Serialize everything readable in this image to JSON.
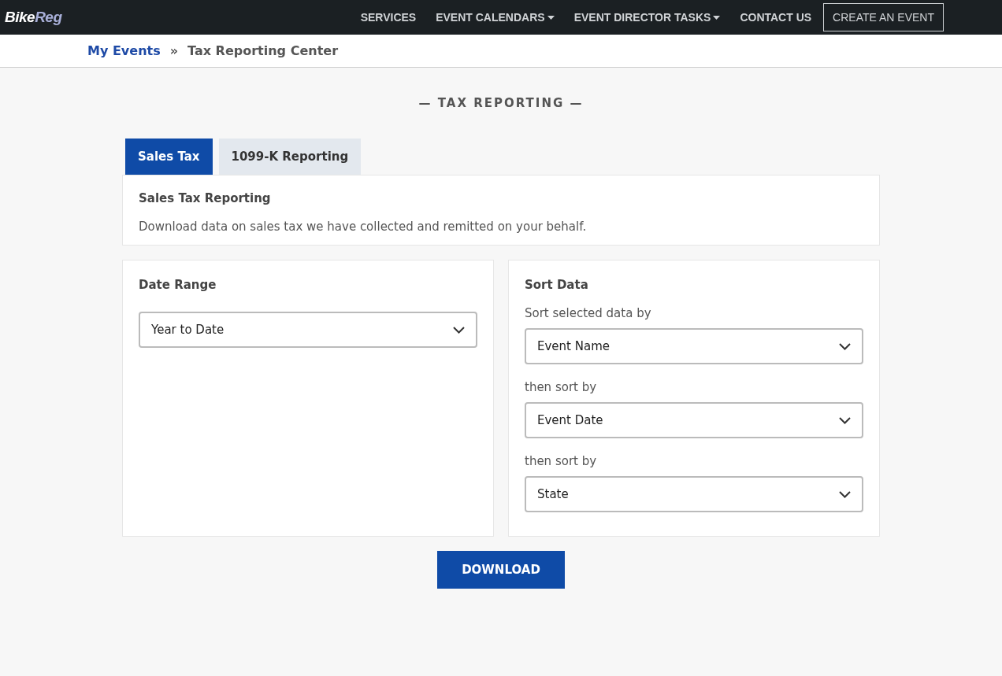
{
  "logo": {
    "first": "Bike",
    "second": "Reg"
  },
  "nav": [
    {
      "label": "SERVICES",
      "kind": "link"
    },
    {
      "label": "EVENT CALENDARS",
      "kind": "dropdown"
    },
    {
      "label": "EVENT DIRECTOR TASKS",
      "kind": "dropdown"
    },
    {
      "label": "CONTACT US",
      "kind": "link"
    },
    {
      "label": "CREATE AN EVENT",
      "kind": "button"
    }
  ],
  "breadcrumb": {
    "link": "My Events",
    "separator": "»",
    "current": "Tax Reporting Center"
  },
  "heading": "— TAX REPORTING —",
  "tabs": [
    {
      "label": "Sales Tax",
      "selected": true
    },
    {
      "label": "1099-K Reporting",
      "selected": false
    }
  ],
  "intro": {
    "title": "Sales Tax Reporting",
    "text": "Download data on sales tax we have collected and remitted on your behalf."
  },
  "date_range": {
    "title": "Date Range",
    "value": "Year to Date"
  },
  "sort_data": {
    "title": "Sort Data",
    "fields": [
      {
        "label": "Sort selected data by",
        "value": "Event Name"
      },
      {
        "label": "then sort by",
        "value": "Event Date"
      },
      {
        "label": "then sort by",
        "value": "State"
      }
    ]
  },
  "download_button": "DOWNLOAD"
}
